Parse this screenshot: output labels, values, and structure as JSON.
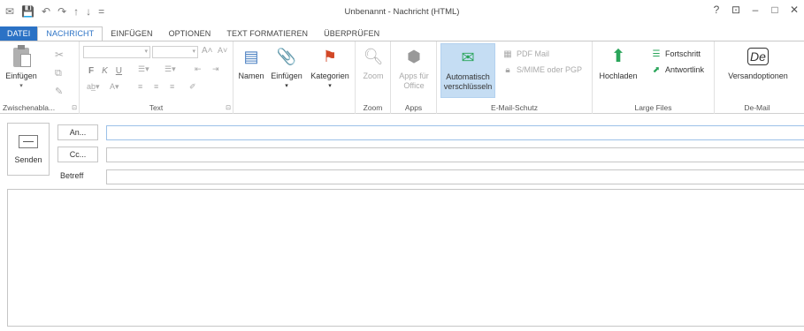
{
  "window": {
    "title": "Unbenannt - Nachricht (HTML)",
    "help": "?",
    "controls": [
      "⊡",
      "–",
      "□",
      "✕"
    ]
  },
  "qat": [
    "✉",
    "💾",
    "↶",
    "↷",
    "↑",
    "↓",
    "="
  ],
  "tabs": [
    "DATEI",
    "NACHRICHT",
    "EINFÜGEN",
    "OPTIONEN",
    "TEXT FORMATIEREN",
    "ÜBERPRÜFEN"
  ],
  "ribbon": {
    "clipboard": {
      "paste": "Einfügen",
      "label": "Zwischenabla...",
      "launcher": "⊡"
    },
    "text": {
      "label": "Text",
      "launcher": "⊡",
      "bold": "F",
      "italic": "K",
      "underline": "U"
    },
    "names": {
      "names": "Namen",
      "insert": "Einfügen",
      "categories": "Kategorien"
    },
    "zoom": {
      "zoom": "Zoom",
      "label": "Zoom"
    },
    "apps": {
      "apps": "Apps für Office",
      "label": "Apps"
    },
    "email_protection": {
      "auto_encrypt": "Automatisch verschlüsseln",
      "pdf_mail": "PDF Mail",
      "smime": "S/MIME oder PGP",
      "label": "E-Mail-Schutz"
    },
    "large_files": {
      "upload": "Hochladen",
      "progress": "Fortschritt",
      "reply_link": "Antwortlink",
      "label": "Large Files"
    },
    "demail": {
      "logo": "De",
      "send_options": "Versandoptionen",
      "label": "De-Mail"
    }
  },
  "compose": {
    "send": "Senden",
    "to": "An...",
    "cc": "Cc...",
    "subject": "Betreff",
    "to_value": "",
    "cc_value": "",
    "subject_value": ""
  },
  "colors": {
    "accent": "#2b72c5",
    "highlight": "#c5ddf3",
    "green": "#2aa55a",
    "red": "#d24726"
  }
}
